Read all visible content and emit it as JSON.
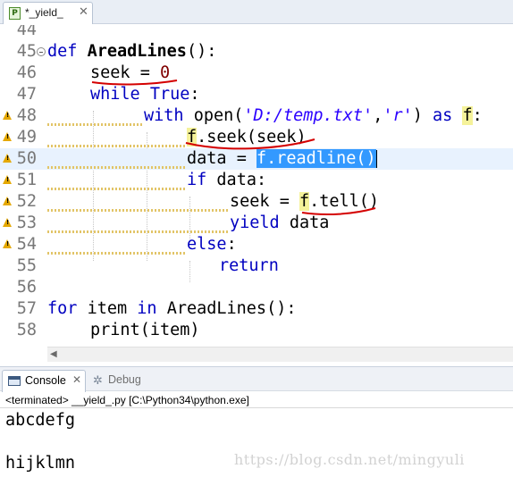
{
  "editor_tab": {
    "icon": "python-file-icon",
    "icon_glyph": "P",
    "label": "*_yield_",
    "close": "✕"
  },
  "lines": {
    "l44": {
      "num": "44"
    },
    "l45": {
      "num": "45",
      "def": "def ",
      "name": "AreadLines",
      "rest": "():"
    },
    "l46": {
      "num": "46",
      "text": "seek = ",
      "zero": "0"
    },
    "l47": {
      "num": "47",
      "kw": "while ",
      "kw2": "True",
      "rest": ":"
    },
    "l48": {
      "num": "48",
      "kw": "with ",
      "call": "open(",
      "s1": "'D:/temp.txt'",
      "comma": ",",
      "s2": "'r'",
      "close": ") ",
      "as": "as ",
      "f": "f",
      "colon": ":"
    },
    "l49": {
      "num": "49",
      "f": "f",
      "rest": ".seek(seek)"
    },
    "l50": {
      "num": "50",
      "lhs": "data = ",
      "sel": "f.readline()"
    },
    "l51": {
      "num": "51",
      "kw": "if ",
      "rest": "data:"
    },
    "l52": {
      "num": "52",
      "lhs": "seek = ",
      "f": "f",
      "rest": ".tell()"
    },
    "l53": {
      "num": "53",
      "kw": "yield ",
      "rest": "data"
    },
    "l54": {
      "num": "54",
      "kw": "else",
      "rest": ":"
    },
    "l55": {
      "num": "55",
      "kw": "return"
    },
    "l56": {
      "num": "56"
    },
    "l57": {
      "num": "57",
      "kw": "for ",
      "v": "item ",
      "kw2": "in ",
      "rest": "AreadLines():"
    },
    "l58": {
      "num": "58",
      "rest": "print(item)"
    }
  },
  "console": {
    "tab_label": "Console",
    "tab_close": "✕",
    "debug_label": "Debug",
    "status": "<terminated> __yield_.py [C:\\Python34\\python.exe]",
    "output": [
      "abcdefg",
      "",
      "hijklmn"
    ]
  },
  "watermark": "https://blog.csdn.net/mingyuli",
  "colors": {
    "keyword": "#0000c0",
    "string": "#2a00ff",
    "number": "#800000",
    "selection": "#3399ff",
    "occurrence_highlight": "#f5f29a",
    "annotation_ink": "#d40000"
  }
}
